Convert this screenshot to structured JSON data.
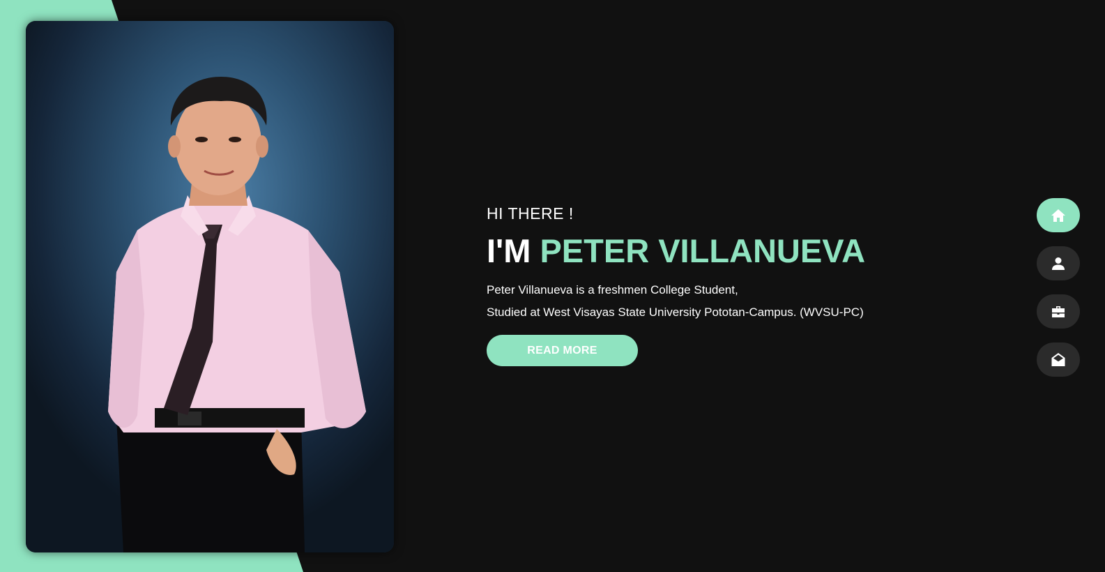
{
  "colors": {
    "background": "#111111",
    "accent": "#8fe3c0",
    "nav_button": "#2b2b2b",
    "text": "#ffffff"
  },
  "hero": {
    "greeting": "HI THERE !",
    "headline_prefix": "I'M",
    "headline_name": "PETER VILLANUEVA",
    "bio_line_1": "Peter Villanueva is a freshmen College Student,",
    "bio_line_2": "Studied at West Visayas State University Pototan-Campus. (WVSU-PC)",
    "read_more_label": "READ MORE"
  },
  "side_nav": {
    "items": [
      {
        "icon": "home-icon",
        "active": true
      },
      {
        "icon": "user-icon",
        "active": false
      },
      {
        "icon": "briefcase-icon",
        "active": false
      },
      {
        "icon": "envelope-open-icon",
        "active": false
      }
    ]
  }
}
